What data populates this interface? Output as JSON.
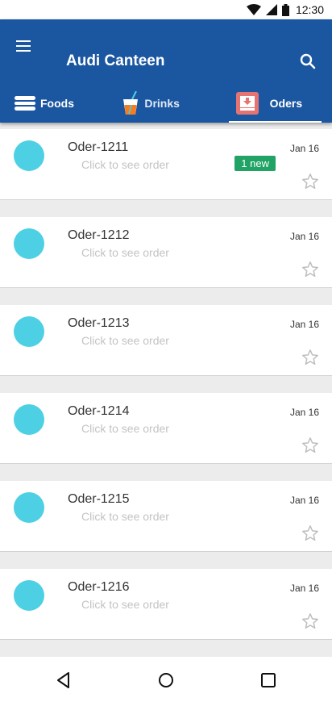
{
  "status_bar": {
    "time": "12:30",
    "icons": [
      "wifi-icon",
      "cellular-signal-icon",
      "battery-icon"
    ]
  },
  "app_bar": {
    "title": "Audi Canteen",
    "menu_icon": "hamburger-menu-icon",
    "search_icon": "search-icon",
    "color": "#1b56a0"
  },
  "tabs": [
    {
      "label": "Foods",
      "icon": "burger-icon",
      "active": false
    },
    {
      "label": "Drinks",
      "icon": "drink-cup-icon",
      "active": false
    },
    {
      "label": "Oders",
      "icon": "inbox-download-icon",
      "active": true
    }
  ],
  "orders": [
    {
      "title": "Oder-1211",
      "subtitle": "Click to see order",
      "date": "Jan 16",
      "badge": "1 new"
    },
    {
      "title": "Oder-1212",
      "subtitle": "Click to see order",
      "date": "Jan 16",
      "badge": ""
    },
    {
      "title": "Oder-1213",
      "subtitle": "Click to see order",
      "date": "Jan 16",
      "badge": ""
    },
    {
      "title": "Oder-1214",
      "subtitle": "Click to see order",
      "date": "Jan 16",
      "badge": ""
    },
    {
      "title": "Oder-1215",
      "subtitle": "Click to see order",
      "date": "Jan 16",
      "badge": ""
    },
    {
      "title": "Oder-1216",
      "subtitle": "Click to see order",
      "date": "Jan 16",
      "badge": ""
    }
  ],
  "colors": {
    "avatar": "#4dd0e4",
    "badge": "#21a366"
  },
  "nav_bar": {
    "icons": [
      "back-icon",
      "home-icon",
      "recents-icon"
    ]
  }
}
